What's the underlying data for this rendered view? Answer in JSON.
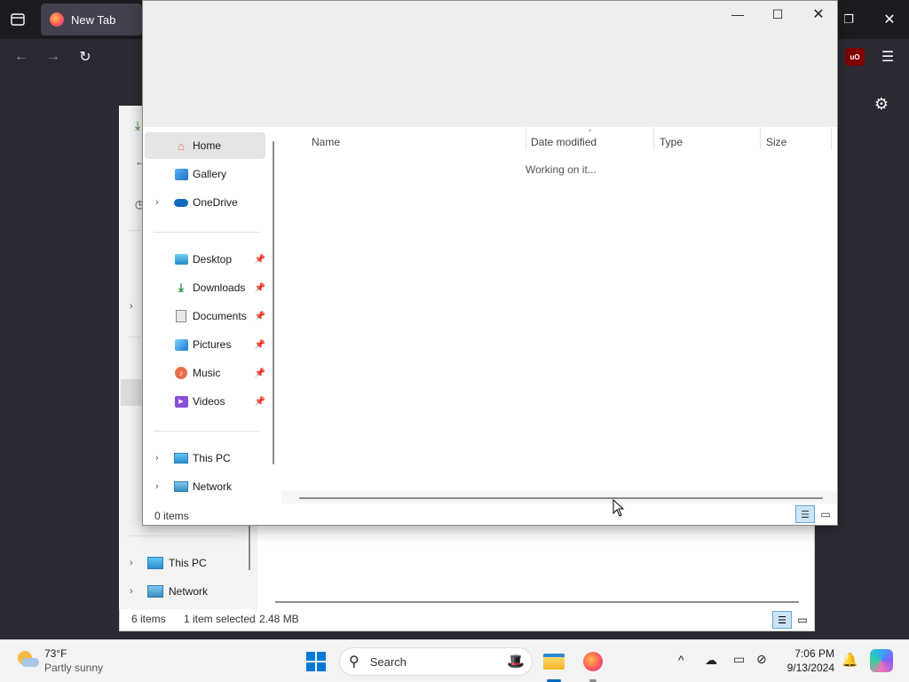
{
  "firefox": {
    "tab_title": "New Tab"
  },
  "background_explorer": {
    "nav": [
      "This PC",
      "Network"
    ],
    "status_items": "6 items",
    "status_selected": "1 item selected",
    "status_size": "2.48 MB"
  },
  "dialog": {
    "nav": {
      "home": "Home",
      "gallery": "Gallery",
      "onedrive": "OneDrive",
      "desktop": "Desktop",
      "downloads": "Downloads",
      "documents": "Documents",
      "pictures": "Pictures",
      "music": "Music",
      "videos": "Videos",
      "this_pc": "This PC",
      "network": "Network"
    },
    "columns": {
      "name": "Name",
      "date_modified": "Date modified",
      "type": "Type",
      "size": "Size"
    },
    "loading_text": "Working on it...",
    "status_items": "0 items"
  },
  "taskbar": {
    "weather_temp": "73°F",
    "weather_desc": "Partly sunny",
    "search_label": "Search",
    "time": "7:06 PM",
    "date": "9/13/2024"
  },
  "colors": {
    "accent": "#0067c0",
    "firefox_dark": "#1c1b22",
    "firefox_toolbar": "#2b2a33"
  }
}
